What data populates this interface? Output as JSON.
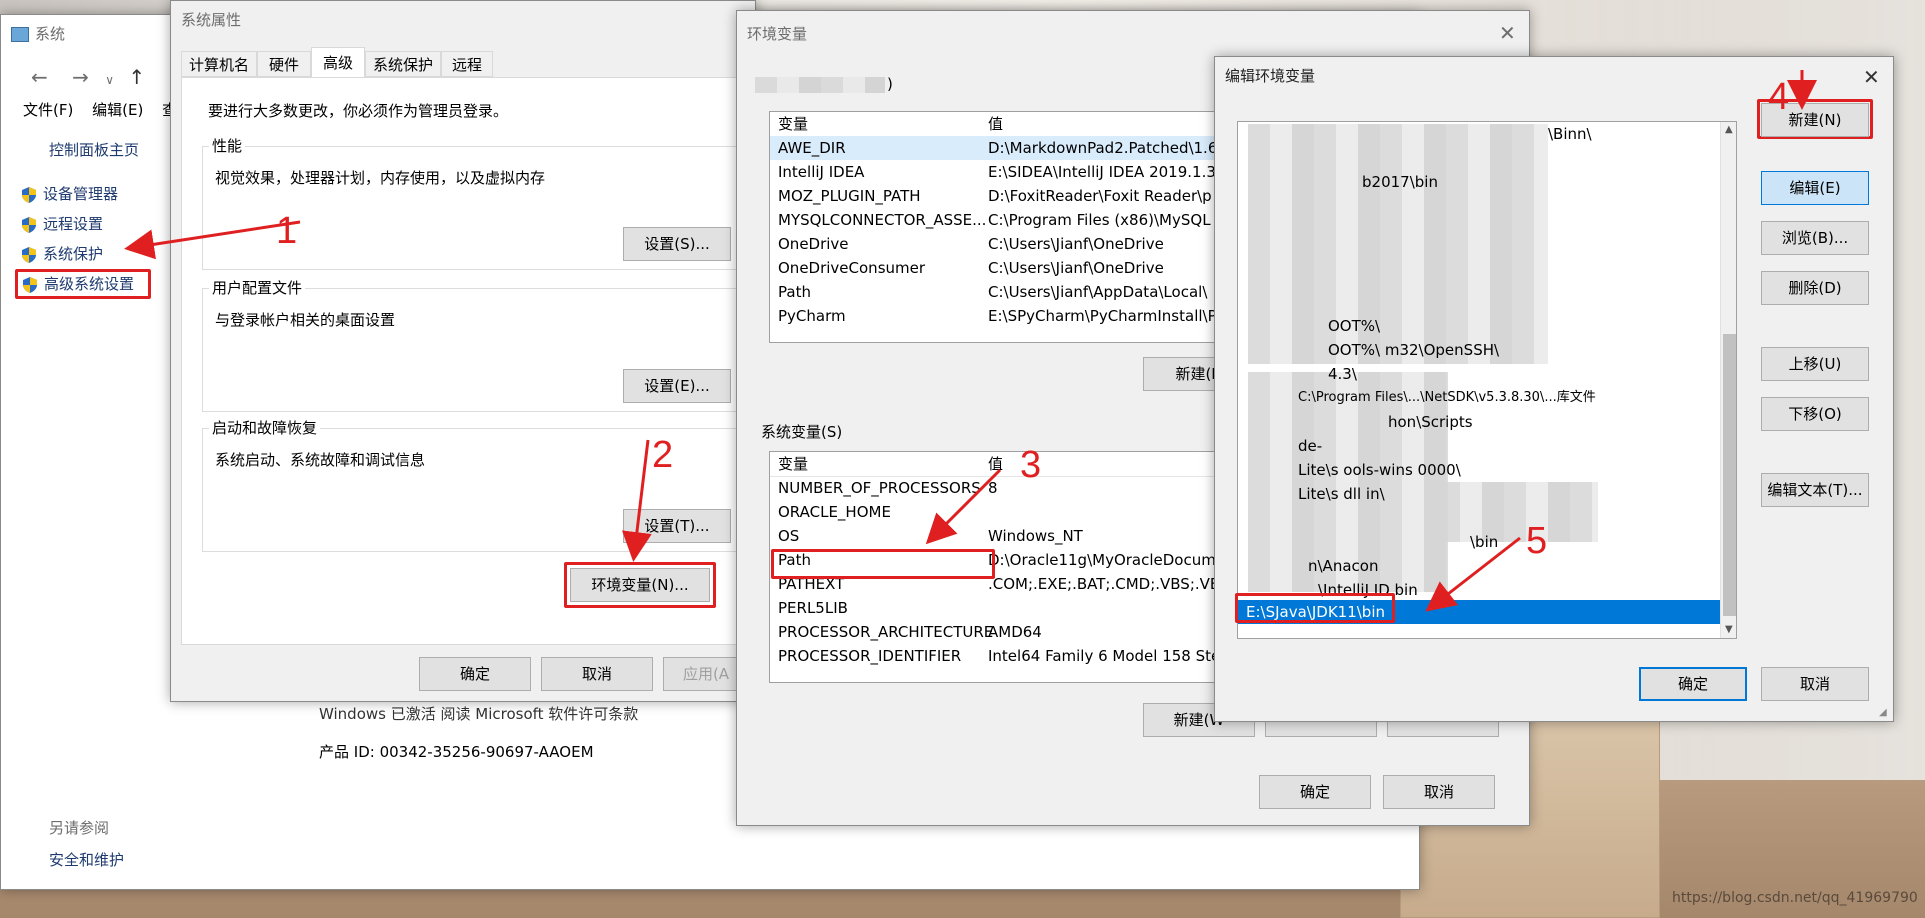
{
  "system_window": {
    "title": "系统",
    "menu": [
      "文件(F)",
      "编辑(E)",
      "查"
    ],
    "control_panel_home": "控制面板主页",
    "links": [
      "设备管理器",
      "远程设置",
      "系统保护",
      "高级系统设置"
    ],
    "see_also_title": "另请参阅",
    "security_link": "安全和维护",
    "activation_text": "Windows 已激活   阅读 Microsoft 软件许可条款",
    "product_id": "产品 ID: 00342-35256-90697-AAOEM"
  },
  "sys_props": {
    "title": "系统属性",
    "tabs": [
      "计算机名",
      "硬件",
      "高级",
      "系统保护",
      "远程"
    ],
    "active_tab": "高级",
    "admin_notice": "要进行大多数更改，你必须作为管理员登录。",
    "perf_title": "性能",
    "perf_desc": "视觉效果，处理器计划，内存使用，以及虚拟内存",
    "perf_btn": "设置(S)...",
    "profile_title": "用户配置文件",
    "profile_desc": "与登录帐户相关的桌面设置",
    "profile_btn": "设置(E)...",
    "startup_title": "启动和故障恢复",
    "startup_desc": "系统启动、系统故障和调试信息",
    "startup_btn": "设置(T)...",
    "env_btn": "环境变量(N)...",
    "ok": "确定",
    "cancel": "取消",
    "apply": "应用(A"
  },
  "env_vars": {
    "title": "环境变量",
    "user_vars_title_suffix": ")",
    "header_var": "变量",
    "header_val": "值",
    "user_rows": [
      {
        "name": "AWE_DIR",
        "value": "D:\\MarkdownPad2.Patched\\1.6"
      },
      {
        "name": "IntelliJ IDEA",
        "value": "E:\\SIDEA\\IntelliJ IDEA 2019.1.3\\"
      },
      {
        "name": "MOZ_PLUGIN_PATH",
        "value": "D:\\FoxitReader\\Foxit Reader\\p"
      },
      {
        "name": "MYSQLCONNECTOR_ASSE...",
        "value": "C:\\Program Files (x86)\\MySQL"
      },
      {
        "name": "OneDrive",
        "value": "C:\\Users\\Jianf\\OneDrive"
      },
      {
        "name": "OneDriveConsumer",
        "value": "C:\\Users\\Jianf\\OneDrive"
      },
      {
        "name": "Path",
        "value": "C:\\Users\\Jianf\\AppData\\Local\\"
      },
      {
        "name": "PyCharm",
        "value": "E:\\SPyCharm\\PyCharmInstall\\Py"
      }
    ],
    "user_new_btn": "新建(N",
    "system_vars_title": "系统变量(S)",
    "sys_rows": [
      {
        "name": "NUMBER_OF_PROCESSORS",
        "value": "8"
      },
      {
        "name": "ORACLE_HOME",
        "value": ""
      },
      {
        "name": "OS",
        "value": "Windows_NT"
      },
      {
        "name": "Path",
        "value": "D:\\Oracle11g\\MyOracleDocum"
      },
      {
        "name": "PATHEXT",
        "value": ".COM;.EXE;.BAT;.CMD;.VBS;.VB"
      },
      {
        "name": "PERL5LIB",
        "value": ""
      },
      {
        "name": "PROCESSOR_ARCHITECTURE",
        "value": "AMD64"
      },
      {
        "name": "PROCESSOR_IDENTIFIER",
        "value": "Intel64 Family 6 Model 158 Ste"
      }
    ],
    "sys_new_btn": "新建(W",
    "ok": "确定",
    "cancel": "取消"
  },
  "edit_env": {
    "title": "编辑环境变量",
    "path_items": [
      "\\Binn\\",
      "b2017\\bin",
      "",
      "",
      "",
      "",
      "",
      "",
      "OOT%\\",
      "OOT%\\     m32\\OpenSSH\\",
      "4.3\\",
      "C:\\Program Files\\...\\NetSDK\\v5.3.8.30\\...库文件",
      "hon\\Scripts",
      "de-",
      "Lite\\s    ools-wins           0000\\",
      "Lite\\s    dll              in\\",
      "",
      "\\bin",
      "n\\Anacon",
      "\\IntelliJ ID            bin",
      "E:\\SJava\\JDK11\\bin"
    ],
    "selected_item": "E:\\SJava\\JDK11\\bin",
    "buttons": [
      "新建(N)",
      "编辑(E)",
      "浏览(B)...",
      "删除(D)",
      "上移(U)",
      "下移(O)",
      "编辑文本(T)..."
    ],
    "ok": "确定",
    "cancel": "取消"
  },
  "annotations": [
    "1",
    "2",
    "3",
    "4",
    "5"
  ],
  "watermark": "https://blog.csdn.net/qq_41969790",
  "colors": {
    "annotation_red": "#e02020",
    "selection_blue": "#0078d7",
    "button_gray": "#e1e1e1"
  }
}
